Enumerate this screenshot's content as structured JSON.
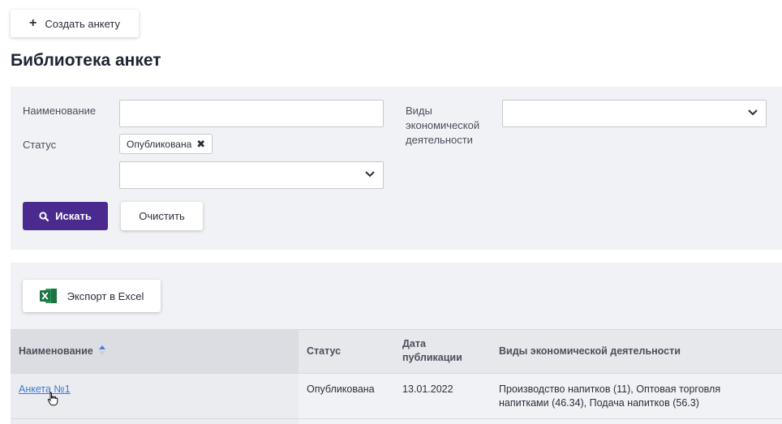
{
  "toolbar": {
    "create_label": "Создать анкету"
  },
  "page": {
    "title": "Библиотека анкет"
  },
  "filters": {
    "name_label": "Наименование",
    "name_value": "",
    "status_label": "Статус",
    "status_tag": "Опубликована",
    "status_select_value": "",
    "activity_label": "Виды экономической деятельности",
    "activity_value": "",
    "search_label": "Искать",
    "clear_label": "Очистить"
  },
  "results": {
    "export_label": "Экспорт в Excel",
    "columns": [
      "Наименование",
      "Статус",
      "Дата публикации",
      "Виды экономической деятельности"
    ],
    "rows": [
      {
        "name": "Анкета №1",
        "status": "Опубликована",
        "date": "13.01.2022",
        "activities": "Производство напитков (11), Оптовая торговля напитками (46.34), Подача напитков (56.3)"
      }
    ]
  },
  "colors": {
    "accent": "#4a2a8e",
    "link": "#3a7bd5",
    "panel": "#f1f2f6",
    "excel": "#1f7244"
  },
  "icons": [
    "plus-icon",
    "close-icon",
    "chevron-down-icon",
    "search-icon",
    "excel-icon",
    "sort-asc-icon",
    "hand-cursor-icon"
  ]
}
